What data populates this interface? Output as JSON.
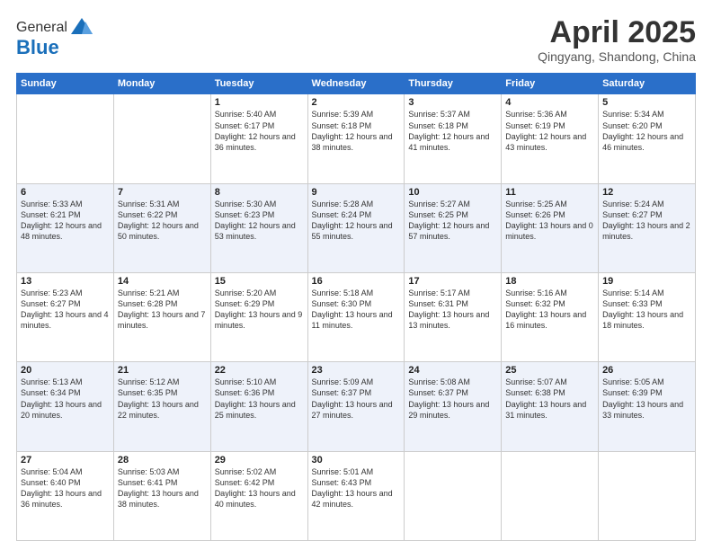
{
  "header": {
    "logo_general": "General",
    "logo_blue": "Blue",
    "month_title": "April 2025",
    "location": "Qingyang, Shandong, China"
  },
  "weekdays": [
    "Sunday",
    "Monday",
    "Tuesday",
    "Wednesday",
    "Thursday",
    "Friday",
    "Saturday"
  ],
  "weeks": [
    [
      {
        "day": "",
        "info": ""
      },
      {
        "day": "",
        "info": ""
      },
      {
        "day": "1",
        "info": "Sunrise: 5:40 AM\nSunset: 6:17 PM\nDaylight: 12 hours and 36 minutes."
      },
      {
        "day": "2",
        "info": "Sunrise: 5:39 AM\nSunset: 6:18 PM\nDaylight: 12 hours and 38 minutes."
      },
      {
        "day": "3",
        "info": "Sunrise: 5:37 AM\nSunset: 6:18 PM\nDaylight: 12 hours and 41 minutes."
      },
      {
        "day": "4",
        "info": "Sunrise: 5:36 AM\nSunset: 6:19 PM\nDaylight: 12 hours and 43 minutes."
      },
      {
        "day": "5",
        "info": "Sunrise: 5:34 AM\nSunset: 6:20 PM\nDaylight: 12 hours and 46 minutes."
      }
    ],
    [
      {
        "day": "6",
        "info": "Sunrise: 5:33 AM\nSunset: 6:21 PM\nDaylight: 12 hours and 48 minutes."
      },
      {
        "day": "7",
        "info": "Sunrise: 5:31 AM\nSunset: 6:22 PM\nDaylight: 12 hours and 50 minutes."
      },
      {
        "day": "8",
        "info": "Sunrise: 5:30 AM\nSunset: 6:23 PM\nDaylight: 12 hours and 53 minutes."
      },
      {
        "day": "9",
        "info": "Sunrise: 5:28 AM\nSunset: 6:24 PM\nDaylight: 12 hours and 55 minutes."
      },
      {
        "day": "10",
        "info": "Sunrise: 5:27 AM\nSunset: 6:25 PM\nDaylight: 12 hours and 57 minutes."
      },
      {
        "day": "11",
        "info": "Sunrise: 5:25 AM\nSunset: 6:26 PM\nDaylight: 13 hours and 0 minutes."
      },
      {
        "day": "12",
        "info": "Sunrise: 5:24 AM\nSunset: 6:27 PM\nDaylight: 13 hours and 2 minutes."
      }
    ],
    [
      {
        "day": "13",
        "info": "Sunrise: 5:23 AM\nSunset: 6:27 PM\nDaylight: 13 hours and 4 minutes."
      },
      {
        "day": "14",
        "info": "Sunrise: 5:21 AM\nSunset: 6:28 PM\nDaylight: 13 hours and 7 minutes."
      },
      {
        "day": "15",
        "info": "Sunrise: 5:20 AM\nSunset: 6:29 PM\nDaylight: 13 hours and 9 minutes."
      },
      {
        "day": "16",
        "info": "Sunrise: 5:18 AM\nSunset: 6:30 PM\nDaylight: 13 hours and 11 minutes."
      },
      {
        "day": "17",
        "info": "Sunrise: 5:17 AM\nSunset: 6:31 PM\nDaylight: 13 hours and 13 minutes."
      },
      {
        "day": "18",
        "info": "Sunrise: 5:16 AM\nSunset: 6:32 PM\nDaylight: 13 hours and 16 minutes."
      },
      {
        "day": "19",
        "info": "Sunrise: 5:14 AM\nSunset: 6:33 PM\nDaylight: 13 hours and 18 minutes."
      }
    ],
    [
      {
        "day": "20",
        "info": "Sunrise: 5:13 AM\nSunset: 6:34 PM\nDaylight: 13 hours and 20 minutes."
      },
      {
        "day": "21",
        "info": "Sunrise: 5:12 AM\nSunset: 6:35 PM\nDaylight: 13 hours and 22 minutes."
      },
      {
        "day": "22",
        "info": "Sunrise: 5:10 AM\nSunset: 6:36 PM\nDaylight: 13 hours and 25 minutes."
      },
      {
        "day": "23",
        "info": "Sunrise: 5:09 AM\nSunset: 6:37 PM\nDaylight: 13 hours and 27 minutes."
      },
      {
        "day": "24",
        "info": "Sunrise: 5:08 AM\nSunset: 6:37 PM\nDaylight: 13 hours and 29 minutes."
      },
      {
        "day": "25",
        "info": "Sunrise: 5:07 AM\nSunset: 6:38 PM\nDaylight: 13 hours and 31 minutes."
      },
      {
        "day": "26",
        "info": "Sunrise: 5:05 AM\nSunset: 6:39 PM\nDaylight: 13 hours and 33 minutes."
      }
    ],
    [
      {
        "day": "27",
        "info": "Sunrise: 5:04 AM\nSunset: 6:40 PM\nDaylight: 13 hours and 36 minutes."
      },
      {
        "day": "28",
        "info": "Sunrise: 5:03 AM\nSunset: 6:41 PM\nDaylight: 13 hours and 38 minutes."
      },
      {
        "day": "29",
        "info": "Sunrise: 5:02 AM\nSunset: 6:42 PM\nDaylight: 13 hours and 40 minutes."
      },
      {
        "day": "30",
        "info": "Sunrise: 5:01 AM\nSunset: 6:43 PM\nDaylight: 13 hours and 42 minutes."
      },
      {
        "day": "",
        "info": ""
      },
      {
        "day": "",
        "info": ""
      },
      {
        "day": "",
        "info": ""
      }
    ]
  ]
}
